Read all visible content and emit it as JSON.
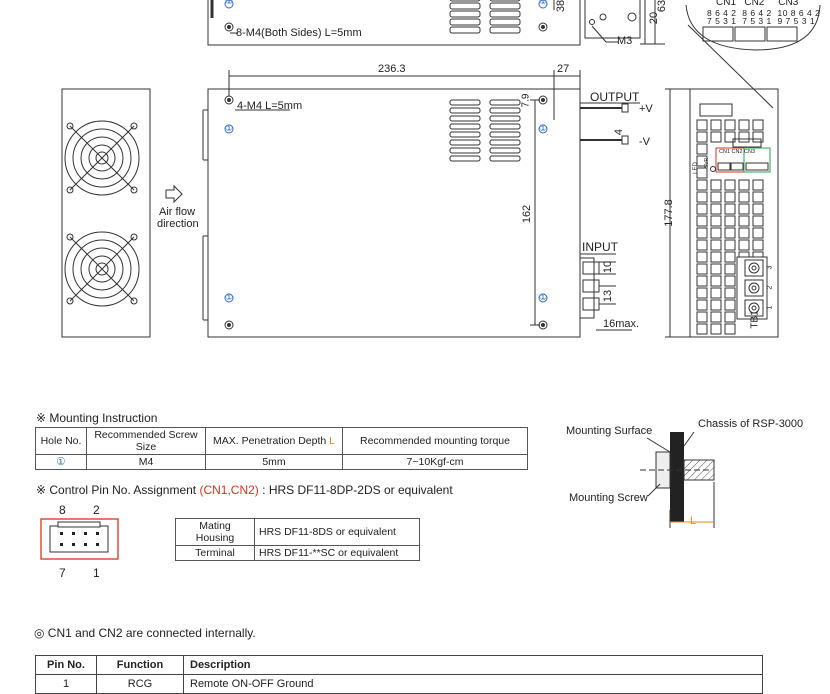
{
  "drawing": {
    "top_m3": "M3",
    "top_note": "8-M4(Both Sides) L=5mm",
    "top_dim_38": "38",
    "top_dim_20": "20",
    "top_dim_63": "63",
    "cn_header": {
      "cn1": "CN1",
      "cn2": "CN2",
      "cn3": "CN3",
      "cn1_top": "8 6 4 2",
      "cn2_top": "8 6 4 2",
      "cn3_top": "10 8 6 4 2",
      "cn1_bot": "7 5 3 1",
      "cn2_bot": "7 5 3 1",
      "cn3_bot": "9 7 5 3 1"
    },
    "dim_width": "236.3",
    "dim_depth": "27",
    "dim_79": "7.9",
    "dim_162": "162",
    "dim_4": "4",
    "dim_1778": "177.8",
    "dim_10": "10",
    "dim_13": "13",
    "dim_16max": "16max.",
    "side_note": "4-M4 L=5mm",
    "hole_mark": "①",
    "output_label": "OUTPUT",
    "plus_v": "+V",
    "minus_v": "-V",
    "input_label": "INPUT",
    "airflow_line1": "Air flow",
    "airflow_line2": "direction",
    "tb1": "TB1",
    "tb_nums": [
      "3",
      "2",
      "1"
    ],
    "led": "LED",
    "svr": "SVR",
    "panel_cn": "CN1  CN2   CN3"
  },
  "mounting": {
    "title": "※ Mounting Instruction",
    "headers": [
      "Hole No.",
      "Recommended Screw Size",
      "MAX. Penetration Depth",
      "Recommended mounting torque"
    ],
    "depth_symbol": "L",
    "row": [
      "①",
      "M4",
      "5mm",
      "7~10Kgf-cm"
    ]
  },
  "side_diagram": {
    "mounting_surface": "Mounting Surface",
    "chassis": "Chassis of RSP-3000",
    "mounting_screw": "Mounting Screw",
    "l_label": "L"
  },
  "control_pin": {
    "prefix": "※ Control Pin No. Assignment ",
    "highlight": "(CN1,CN2)",
    "suffix": " : HRS DF11-8DP-2DS or equivalent",
    "pin_top_left": "8",
    "pin_top_right": "2",
    "pin_bot_left": "7",
    "pin_bot_right": "1"
  },
  "mating": {
    "rows": [
      [
        "Mating Housing",
        "HRS DF11-8DS or equivalent"
      ],
      [
        "Terminal",
        "HRS DF11-**SC or equivalent"
      ]
    ]
  },
  "note": "◎ CN1 and CN2 are connected internally.",
  "pin_table": {
    "headers": [
      "Pin No.",
      "Function",
      "Description"
    ],
    "row1": [
      "1",
      "RCG",
      "Remote ON-OFF Ground"
    ]
  }
}
